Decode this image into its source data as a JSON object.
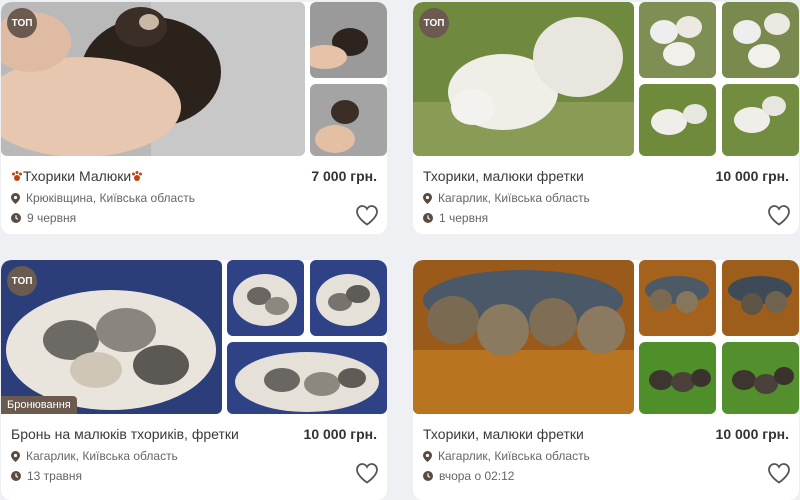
{
  "listings": [
    {
      "title": "Тхорики Малюки",
      "price": "7 000 грн.",
      "location": "Крюківщина, Київська область",
      "date": "9 червня",
      "badge": "ТОП",
      "icon_location": "location-pin-icon",
      "icon_date": "clock-icon",
      "icon_fav": "heart-icon"
    },
    {
      "title": "Тхорики, малюки фретки",
      "price": "10 000 грн.",
      "location": "Кагарлик, Київська область",
      "date": "1 червня",
      "badge": "ТОП"
    },
    {
      "title": "Бронь на малюків тхориків, фретки",
      "price": "10 000 грн.",
      "location": "Кагарлик, Київська область",
      "date": "13 травня",
      "badge": "ТОП",
      "status": "Бронювання"
    },
    {
      "title": "Тхорики, малюки фретки",
      "price": "10 000 грн.",
      "location": "Кагарлик, Київська область",
      "date": "вчора о 02:12"
    }
  ],
  "colors": {
    "badge_bg": "#6b5a4e",
    "paw": "#c2410c"
  }
}
